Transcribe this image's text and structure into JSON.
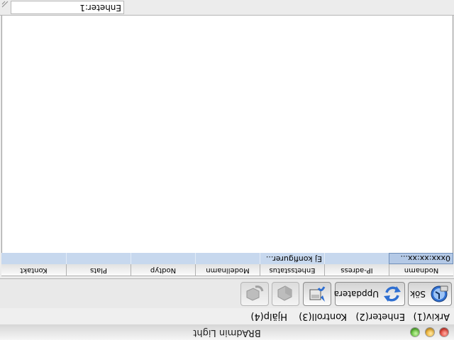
{
  "window": {
    "title": "BRAdmin Light"
  },
  "menu": [
    {
      "label": "Arkiv(1)"
    },
    {
      "label": "Enheter(2)"
    },
    {
      "label": "Kontroll(3)"
    },
    {
      "label": "Hjälp(4)"
    }
  ],
  "toolbar": {
    "search_label": "Sök",
    "refresh_label": "Uppdatera"
  },
  "table": {
    "columns": [
      "Nodnamn",
      "IP-adress",
      "Enhetsstatus",
      "Modellnamn",
      "Nodtyp",
      "Plats",
      "Kontakt"
    ],
    "rows": [
      {
        "nodnamn": "0xxx:xx:xx...",
        "ip": "",
        "status": "Ej konfigurer...",
        "model": "",
        "nodtyp": "",
        "plats": "",
        "kontakt": ""
      }
    ]
  },
  "statusbar": {
    "text": "Enheter:1"
  },
  "icons": [
    "search-icon",
    "refresh-icon",
    "config-icon",
    "device-icon",
    "settings-icon",
    "resize-grip-icon"
  ],
  "colors": {
    "row_highlight": "#c7d8ee",
    "close": "#e5453a",
    "minimize": "#f0b335",
    "zoom": "#61c13a"
  }
}
